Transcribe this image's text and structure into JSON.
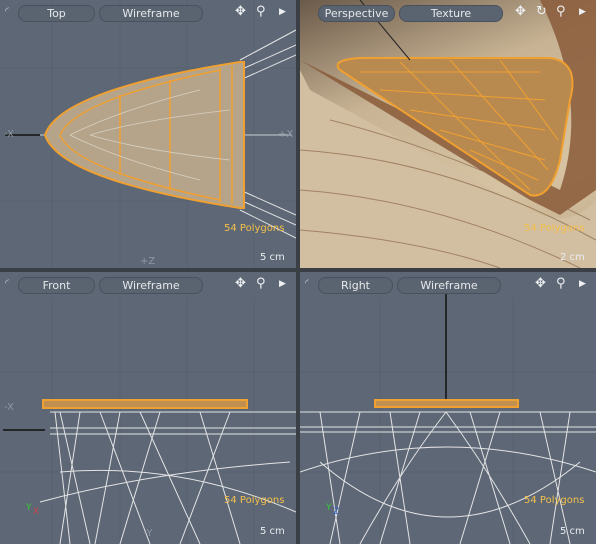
{
  "viewports": [
    {
      "view": "Top",
      "shading": "Wireframe",
      "polygons": "54 Polygons",
      "scale": "5 cm",
      "axes": {
        "left": "-X",
        "right": "+X",
        "bottom": "+Z"
      }
    },
    {
      "view": "Perspective",
      "shading": "Texture",
      "polygons": "54 Polygons",
      "scale": "2 cm"
    },
    {
      "view": "Front",
      "shading": "Wireframe",
      "polygons": "54 Polygons",
      "scale": "5 cm",
      "axes": {
        "left": "-X",
        "bottom": "-Y"
      }
    },
    {
      "view": "Right",
      "shading": "Wireframe",
      "polygons": "54 Polygons",
      "scale": "5 cm"
    }
  ],
  "icons": {
    "pan": "move-arrows-icon",
    "zoom": "magnifier-icon",
    "menu": "triangle-right-icon",
    "rotate": "rotate-icon"
  },
  "colors": {
    "selection": "#f0a030",
    "wire": "#e0e0e0",
    "viewport_bg": "#5d6776",
    "poly_label": "#f4c04a"
  }
}
